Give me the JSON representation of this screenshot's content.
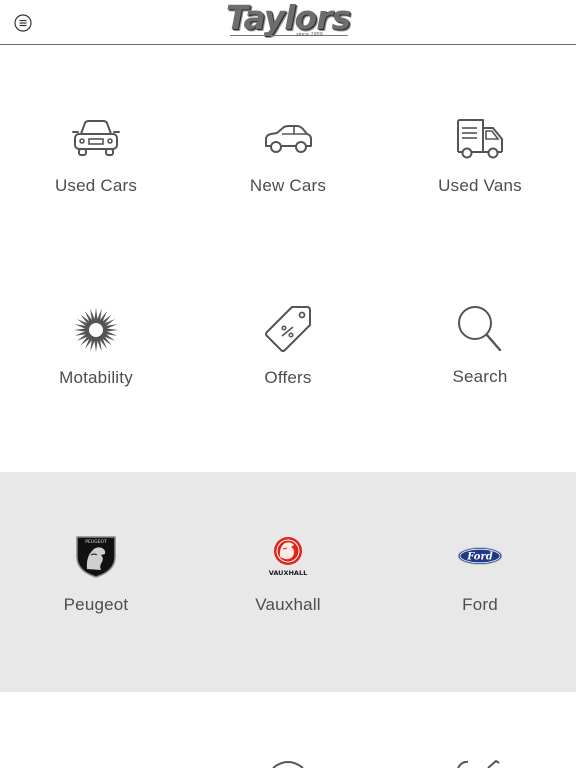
{
  "header": {
    "logo_text": "Taylors",
    "logo_tagline": "since 1959",
    "menu_icon": "hamburger-circle-icon"
  },
  "categories": [
    {
      "label": "Used Cars",
      "icon": "car-front-icon"
    },
    {
      "label": "New Cars",
      "icon": "car-side-icon"
    },
    {
      "label": "Used Vans",
      "icon": "van-icon"
    },
    {
      "label": "Motability",
      "icon": "motability-sunburst-icon"
    },
    {
      "label": "Offers",
      "icon": "price-tag-icon"
    },
    {
      "label": "Search",
      "icon": "search-icon"
    }
  ],
  "brands": [
    {
      "label": "Peugeot",
      "icon": "peugeot-logo-icon",
      "logo_text": "PEUGEOT"
    },
    {
      "label": "Vauxhall",
      "icon": "vauxhall-logo-icon",
      "logo_text": "VAUXHALL",
      "color": "#e2231a"
    },
    {
      "label": "Ford",
      "icon": "ford-logo-icon",
      "logo_text": "Ford",
      "color": "#1f3a8a"
    }
  ],
  "colors": {
    "text": "#4d4d4d",
    "band": "#e8e8e8",
    "divider": "#6b6b6b"
  }
}
